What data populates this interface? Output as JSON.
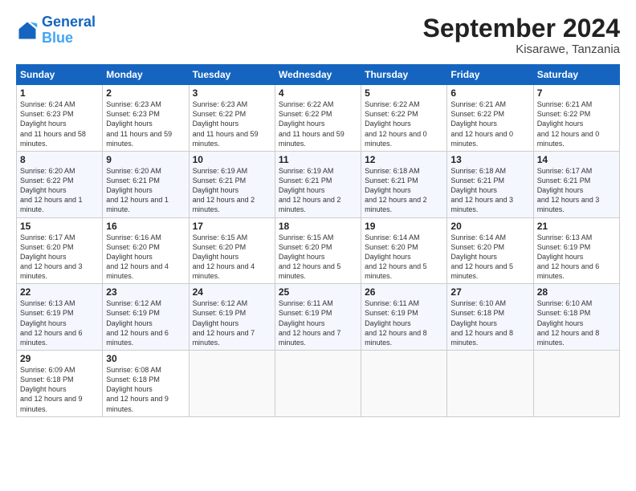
{
  "header": {
    "logo_line1": "General",
    "logo_line2": "Blue",
    "month": "September 2024",
    "location": "Kisarawe, Tanzania"
  },
  "weekdays": [
    "Sunday",
    "Monday",
    "Tuesday",
    "Wednesday",
    "Thursday",
    "Friday",
    "Saturday"
  ],
  "weeks": [
    [
      {
        "day": "1",
        "sunrise": "6:24 AM",
        "sunset": "6:23 PM",
        "daylight": "11 hours and 58 minutes."
      },
      {
        "day": "2",
        "sunrise": "6:23 AM",
        "sunset": "6:23 PM",
        "daylight": "11 hours and 59 minutes."
      },
      {
        "day": "3",
        "sunrise": "6:23 AM",
        "sunset": "6:22 PM",
        "daylight": "11 hours and 59 minutes."
      },
      {
        "day": "4",
        "sunrise": "6:22 AM",
        "sunset": "6:22 PM",
        "daylight": "11 hours and 59 minutes."
      },
      {
        "day": "5",
        "sunrise": "6:22 AM",
        "sunset": "6:22 PM",
        "daylight": "12 hours and 0 minutes."
      },
      {
        "day": "6",
        "sunrise": "6:21 AM",
        "sunset": "6:22 PM",
        "daylight": "12 hours and 0 minutes."
      },
      {
        "day": "7",
        "sunrise": "6:21 AM",
        "sunset": "6:22 PM",
        "daylight": "12 hours and 0 minutes."
      }
    ],
    [
      {
        "day": "8",
        "sunrise": "6:20 AM",
        "sunset": "6:22 PM",
        "daylight": "12 hours and 1 minute."
      },
      {
        "day": "9",
        "sunrise": "6:20 AM",
        "sunset": "6:21 PM",
        "daylight": "12 hours and 1 minute."
      },
      {
        "day": "10",
        "sunrise": "6:19 AM",
        "sunset": "6:21 PM",
        "daylight": "12 hours and 2 minutes."
      },
      {
        "day": "11",
        "sunrise": "6:19 AM",
        "sunset": "6:21 PM",
        "daylight": "12 hours and 2 minutes."
      },
      {
        "day": "12",
        "sunrise": "6:18 AM",
        "sunset": "6:21 PM",
        "daylight": "12 hours and 2 minutes."
      },
      {
        "day": "13",
        "sunrise": "6:18 AM",
        "sunset": "6:21 PM",
        "daylight": "12 hours and 3 minutes."
      },
      {
        "day": "14",
        "sunrise": "6:17 AM",
        "sunset": "6:21 PM",
        "daylight": "12 hours and 3 minutes."
      }
    ],
    [
      {
        "day": "15",
        "sunrise": "6:17 AM",
        "sunset": "6:20 PM",
        "daylight": "12 hours and 3 minutes."
      },
      {
        "day": "16",
        "sunrise": "6:16 AM",
        "sunset": "6:20 PM",
        "daylight": "12 hours and 4 minutes."
      },
      {
        "day": "17",
        "sunrise": "6:15 AM",
        "sunset": "6:20 PM",
        "daylight": "12 hours and 4 minutes."
      },
      {
        "day": "18",
        "sunrise": "6:15 AM",
        "sunset": "6:20 PM",
        "daylight": "12 hours and 5 minutes."
      },
      {
        "day": "19",
        "sunrise": "6:14 AM",
        "sunset": "6:20 PM",
        "daylight": "12 hours and 5 minutes."
      },
      {
        "day": "20",
        "sunrise": "6:14 AM",
        "sunset": "6:20 PM",
        "daylight": "12 hours and 5 minutes."
      },
      {
        "day": "21",
        "sunrise": "6:13 AM",
        "sunset": "6:19 PM",
        "daylight": "12 hours and 6 minutes."
      }
    ],
    [
      {
        "day": "22",
        "sunrise": "6:13 AM",
        "sunset": "6:19 PM",
        "daylight": "12 hours and 6 minutes."
      },
      {
        "day": "23",
        "sunrise": "6:12 AM",
        "sunset": "6:19 PM",
        "daylight": "12 hours and 6 minutes."
      },
      {
        "day": "24",
        "sunrise": "6:12 AM",
        "sunset": "6:19 PM",
        "daylight": "12 hours and 7 minutes."
      },
      {
        "day": "25",
        "sunrise": "6:11 AM",
        "sunset": "6:19 PM",
        "daylight": "12 hours and 7 minutes."
      },
      {
        "day": "26",
        "sunrise": "6:11 AM",
        "sunset": "6:19 PM",
        "daylight": "12 hours and 8 minutes."
      },
      {
        "day": "27",
        "sunrise": "6:10 AM",
        "sunset": "6:18 PM",
        "daylight": "12 hours and 8 minutes."
      },
      {
        "day": "28",
        "sunrise": "6:10 AM",
        "sunset": "6:18 PM",
        "daylight": "12 hours and 8 minutes."
      }
    ],
    [
      {
        "day": "29",
        "sunrise": "6:09 AM",
        "sunset": "6:18 PM",
        "daylight": "12 hours and 9 minutes."
      },
      {
        "day": "30",
        "sunrise": "6:08 AM",
        "sunset": "6:18 PM",
        "daylight": "12 hours and 9 minutes."
      },
      null,
      null,
      null,
      null,
      null
    ]
  ]
}
